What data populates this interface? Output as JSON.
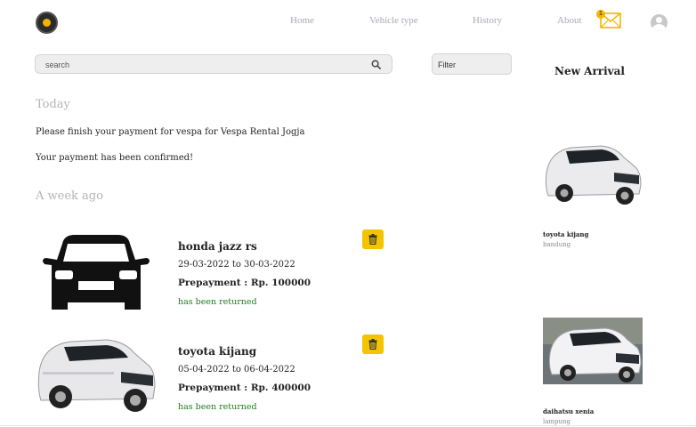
{
  "nav": {
    "links": [
      "Home",
      "Vehicle type",
      "History",
      "About"
    ],
    "mail_badge": "1",
    "icons": {
      "logo": "logo-icon",
      "mail": "mail-icon",
      "avatar": "avatar-icon"
    }
  },
  "search": {
    "placeholder": "search"
  },
  "filter": {
    "label": "Filter"
  },
  "today": {
    "heading": "Today",
    "notifications": [
      "Please finish your payment for vespa for Vespa Rental Jogja",
      "Your payment has been confirmed!"
    ]
  },
  "week_ago": {
    "heading": "A week ago",
    "items": [
      {
        "title": "honda jazz rs",
        "dates": "29-03-2022 to 30-03-2022",
        "prepayment": "Prepayment : Rp. 100000",
        "status": "has been returned"
      },
      {
        "title": "toyota kijang",
        "dates": "05-04-2022 to 06-04-2022",
        "prepayment": "Prepayment : Rp. 400000",
        "status": "has been returned"
      }
    ]
  },
  "sidebar": {
    "title": "New Arrival",
    "items": [
      {
        "name": "toyota kijang",
        "location": "bandung"
      },
      {
        "name": "daihatsu xenia",
        "location": "lampung"
      }
    ]
  },
  "colors": {
    "accent": "#f5c400",
    "status_green": "#1f7a1f",
    "muted_heading": "#b4b4b4",
    "nav_text": "#a8a8b8"
  }
}
